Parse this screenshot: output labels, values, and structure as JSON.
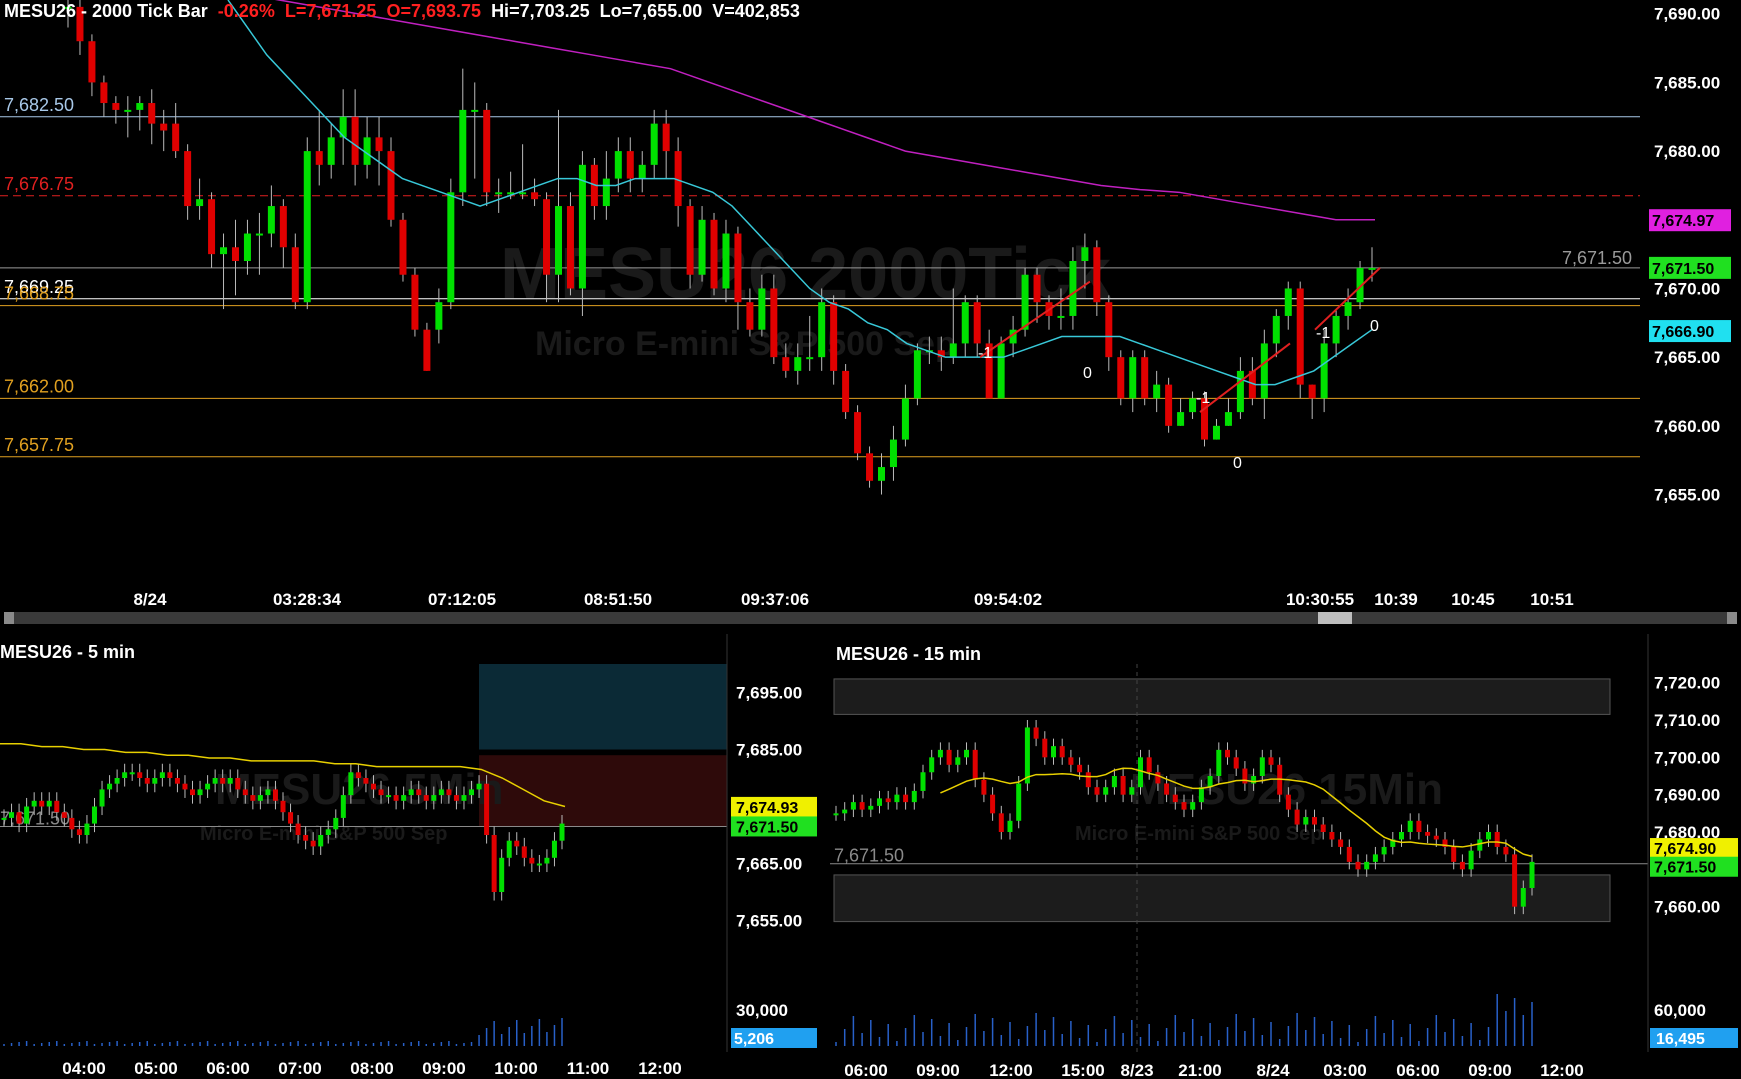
{
  "colors": {
    "up": "#00e000",
    "down": "#e00000",
    "axis_text": "#ffffff",
    "grid_line": "#4a4a4a",
    "ema_cyan": "#38c8d8",
    "sma_magenta": "#c020c0",
    "yellow_ma": "#e8d000"
  },
  "main": {
    "symbol_title": "MESU26 - 2000 Tick Bar",
    "change": "-0.26%",
    "last": "L=7,671.25",
    "open": "O=7,693.75",
    "hi": "Hi=7,703.25",
    "lo": "Lo=7,655.00",
    "volume": "V=402,853",
    "watermark": "MESU26 2000Tick",
    "watermark_sub": "Micro E-mini S&P 500 Sep",
    "y_ticks": [
      "7,690.00",
      "7,685.00",
      "7,680.00",
      "7,675.00",
      "7,670.00",
      "7,665.00",
      "7,660.00",
      "7,655.00"
    ],
    "x_ticks": [
      "8/24",
      "03:28:34",
      "07:12:05",
      "08:51:50",
      "09:37:06",
      "09:54:02",
      "10:30:55",
      "10:39",
      "10:45",
      "10:51"
    ],
    "levels": [
      {
        "label": "7,682.50",
        "color": "#a8c8e8"
      },
      {
        "label": "7,676.75",
        "color": "#e02020"
      },
      {
        "label": "7,669.25",
        "color": "#ffffff"
      },
      {
        "label": "7,668.75",
        "color": "#e0a020"
      },
      {
        "label": "7,662.00",
        "color": "#e0a020"
      },
      {
        "label": "7,657.75",
        "color": "#e0a020"
      }
    ],
    "last_line_label": "7,671.50",
    "price_tags": [
      {
        "label": "7,674.97",
        "bg": "#e020e0",
        "fg": "#000000"
      },
      {
        "label": "7,671.50",
        "bg": "#20e020",
        "fg": "#000000"
      },
      {
        "label": "7,666.90",
        "bg": "#20e0f0",
        "fg": "#000000"
      }
    ],
    "swing_labels": [
      "-1",
      "0",
      "-1",
      "0",
      "-1",
      "0"
    ],
    "chart_data": {
      "type": "candlestick",
      "ylim": [
        7653,
        7691
      ],
      "candles": [
        {
          "o": 7690.5,
          "c": 7690.5,
          "h": 7691.5,
          "l": 7689
        },
        {
          "o": 7690.5,
          "c": 7688,
          "h": 7691,
          "l": 7687
        },
        {
          "o": 7688,
          "c": 7685,
          "h": 7688.5,
          "l": 7684
        },
        {
          "o": 7685,
          "c": 7683.5,
          "h": 7685.5,
          "l": 7682.5
        },
        {
          "o": 7683.5,
          "c": 7683,
          "h": 7684,
          "l": 7682
        },
        {
          "o": 7683,
          "c": 7683,
          "h": 7684,
          "l": 7681
        },
        {
          "o": 7683,
          "c": 7683.5,
          "h": 7684,
          "l": 7681.5
        },
        {
          "o": 7683.5,
          "c": 7682,
          "h": 7684.5,
          "l": 7680.5
        },
        {
          "o": 7682,
          "c": 7681.5,
          "h": 7683,
          "l": 7680
        },
        {
          "o": 7682,
          "c": 7680,
          "h": 7683.5,
          "l": 7679.5
        },
        {
          "o": 7680,
          "c": 7676,
          "h": 7680.5,
          "l": 7675
        },
        {
          "o": 7676,
          "c": 7676.5,
          "h": 7678,
          "l": 7675
        },
        {
          "o": 7676.5,
          "c": 7672.5,
          "h": 7677,
          "l": 7671.5
        },
        {
          "o": 7672.5,
          "c": 7673,
          "h": 7674,
          "l": 7668.5
        },
        {
          "o": 7673,
          "c": 7672,
          "h": 7675,
          "l": 7669.5
        },
        {
          "o": 7672,
          "c": 7674,
          "h": 7675,
          "l": 7671
        },
        {
          "o": 7674,
          "c": 7674,
          "h": 7675.5,
          "l": 7671
        },
        {
          "o": 7674,
          "c": 7676,
          "h": 7677.5,
          "l": 7673
        },
        {
          "o": 7676,
          "c": 7673,
          "h": 7676.5,
          "l": 7671.5
        },
        {
          "o": 7673,
          "c": 7669,
          "h": 7674,
          "l": 7668.5
        },
        {
          "o": 7669,
          "c": 7680,
          "h": 7681,
          "l": 7668.5
        },
        {
          "o": 7680,
          "c": 7679,
          "h": 7683,
          "l": 7677.5
        },
        {
          "o": 7679,
          "c": 7681,
          "h": 7682,
          "l": 7678
        },
        {
          "o": 7681,
          "c": 7682.5,
          "h": 7684.5,
          "l": 7679
        },
        {
          "o": 7682.5,
          "c": 7679,
          "h": 7684.5,
          "l": 7677.5
        },
        {
          "o": 7679,
          "c": 7681,
          "h": 7682.5,
          "l": 7678
        },
        {
          "o": 7681,
          "c": 7680,
          "h": 7682.5,
          "l": 7677.5
        },
        {
          "o": 7680,
          "c": 7675,
          "h": 7681,
          "l": 7674.5
        },
        {
          "o": 7675,
          "c": 7671,
          "h": 7675.5,
          "l": 7670.5
        },
        {
          "o": 7671,
          "c": 7667,
          "h": 7671.5,
          "l": 7666.5
        },
        {
          "o": 7667,
          "c": 7664,
          "h": 7667.5,
          "l": 7664
        },
        {
          "o": 7667,
          "c": 7669,
          "h": 7670,
          "l": 7666
        },
        {
          "o": 7669,
          "c": 7677,
          "h": 7678,
          "l": 7668.5
        },
        {
          "o": 7677,
          "c": 7683,
          "h": 7686,
          "l": 7676
        },
        {
          "o": 7683,
          "c": 7683,
          "h": 7685,
          "l": 7678
        },
        {
          "o": 7683,
          "c": 7677,
          "h": 7683.5,
          "l": 7676
        },
        {
          "o": 7677,
          "c": 7677,
          "h": 7678,
          "l": 7675.5
        },
        {
          "o": 7677,
          "c": 7677,
          "h": 7678.5,
          "l": 7676.5
        },
        {
          "o": 7677,
          "c": 7677,
          "h": 7680.5,
          "l": 7676.5
        },
        {
          "o": 7677,
          "c": 7676.5,
          "h": 7678,
          "l": 7676
        },
        {
          "o": 7676.5,
          "c": 7671,
          "h": 7677,
          "l": 7669
        },
        {
          "o": 7671,
          "c": 7676,
          "h": 7683,
          "l": 7669
        },
        {
          "o": 7676,
          "c": 7670,
          "h": 7677,
          "l": 7669.5
        },
        {
          "o": 7670,
          "c": 7679,
          "h": 7680,
          "l": 7668
        },
        {
          "o": 7679,
          "c": 7676,
          "h": 7679.5,
          "l": 7675
        },
        {
          "o": 7676,
          "c": 7678,
          "h": 7680,
          "l": 7675
        },
        {
          "o": 7678,
          "c": 7680,
          "h": 7681,
          "l": 7677
        },
        {
          "o": 7680,
          "c": 7678,
          "h": 7681,
          "l": 7677
        },
        {
          "o": 7678,
          "c": 7679,
          "h": 7680,
          "l": 7677
        },
        {
          "o": 7679,
          "c": 7682,
          "h": 7683,
          "l": 7678
        },
        {
          "o": 7682,
          "c": 7680,
          "h": 7683,
          "l": 7678
        },
        {
          "o": 7680,
          "c": 7676,
          "h": 7681,
          "l": 7674.5
        },
        {
          "o": 7676,
          "c": 7671,
          "h": 7676.5,
          "l": 7670
        },
        {
          "o": 7671,
          "c": 7675,
          "h": 7676,
          "l": 7670.5
        },
        {
          "o": 7675,
          "c": 7670,
          "h": 7675.5,
          "l": 7669.5
        },
        {
          "o": 7670,
          "c": 7674,
          "h": 7675,
          "l": 7669
        },
        {
          "o": 7674,
          "c": 7669,
          "h": 7674.5,
          "l": 7667
        },
        {
          "o": 7669,
          "c": 7667,
          "h": 7670,
          "l": 7666.5
        },
        {
          "o": 7667,
          "c": 7670,
          "h": 7671,
          "l": 7666.5
        },
        {
          "o": 7670,
          "c": 7665,
          "h": 7671,
          "l": 7664.5
        },
        {
          "o": 7665,
          "c": 7664,
          "h": 7666,
          "l": 7663.5
        },
        {
          "o": 7664,
          "c": 7665,
          "h": 7666,
          "l": 7663
        },
        {
          "o": 7665,
          "c": 7665,
          "h": 7668,
          "l": 7664
        },
        {
          "o": 7665,
          "c": 7669,
          "h": 7670,
          "l": 7664
        },
        {
          "o": 7669,
          "c": 7664,
          "h": 7669.5,
          "l": 7663
        },
        {
          "o": 7664,
          "c": 7661,
          "h": 7664.5,
          "l": 7660.5
        },
        {
          "o": 7661,
          "c": 7658,
          "h": 7661.5,
          "l": 7657.5
        },
        {
          "o": 7658,
          "c": 7656,
          "h": 7658.5,
          "l": 7655.5
        },
        {
          "o": 7656,
          "c": 7657,
          "h": 7658,
          "l": 7655
        },
        {
          "o": 7657,
          "c": 7659,
          "h": 7660,
          "l": 7656
        },
        {
          "o": 7659,
          "c": 7662,
          "h": 7663,
          "l": 7658.5
        },
        {
          "o": 7662,
          "c": 7665.5,
          "h": 7666,
          "l": 7661.5
        },
        {
          "o": 7665.5,
          "c": 7665.5,
          "h": 7666.5,
          "l": 7664.5
        },
        {
          "o": 7665.5,
          "c": 7665,
          "h": 7666.5,
          "l": 7664
        },
        {
          "o": 7665,
          "c": 7666,
          "h": 7670,
          "l": 7664.5
        },
        {
          "o": 7666,
          "c": 7669,
          "h": 7669.5,
          "l": 7665
        },
        {
          "o": 7669,
          "c": 7666,
          "h": 7669.5,
          "l": 7665
        },
        {
          "o": 7666,
          "c": 7662,
          "h": 7667,
          "l": 7662
        },
        {
          "o": 7662,
          "c": 7666,
          "h": 7666.5,
          "l": 7662
        },
        {
          "o": 7666,
          "c": 7667,
          "h": 7668,
          "l": 7665
        },
        {
          "o": 7667,
          "c": 7671,
          "h": 7671.5,
          "l": 7666.5
        },
        {
          "o": 7671,
          "c": 7669,
          "h": 7671.5,
          "l": 7667.5
        },
        {
          "o": 7669,
          "c": 7668,
          "h": 7669.5,
          "l": 7667
        },
        {
          "o": 7668,
          "c": 7668,
          "h": 7670,
          "l": 7667
        },
        {
          "o": 7668,
          "c": 7672,
          "h": 7673,
          "l": 7667
        },
        {
          "o": 7672,
          "c": 7673,
          "h": 7674,
          "l": 7670
        },
        {
          "o": 7673,
          "c": 7669,
          "h": 7673.5,
          "l": 7668
        },
        {
          "o": 7669,
          "c": 7665,
          "h": 7669.5,
          "l": 7664
        },
        {
          "o": 7665,
          "c": 7662,
          "h": 7665.5,
          "l": 7661.5
        },
        {
          "o": 7662,
          "c": 7665,
          "h": 7665.5,
          "l": 7661
        },
        {
          "o": 7665,
          "c": 7662,
          "h": 7665.5,
          "l": 7661.5
        },
        {
          "o": 7662,
          "c": 7663,
          "h": 7664,
          "l": 7661
        },
        {
          "o": 7663,
          "c": 7660,
          "h": 7663.5,
          "l": 7659.5
        },
        {
          "o": 7660,
          "c": 7661,
          "h": 7662,
          "l": 7660
        },
        {
          "o": 7661,
          "c": 7662,
          "h": 7662.5,
          "l": 7660.5
        },
        {
          "o": 7662,
          "c": 7659,
          "h": 7662.5,
          "l": 7658.5
        },
        {
          "o": 7659,
          "c": 7660,
          "h": 7660.5,
          "l": 7659
        },
        {
          "o": 7660,
          "c": 7661,
          "h": 7662,
          "l": 7660
        },
        {
          "o": 7661,
          "c": 7664,
          "h": 7665,
          "l": 7660.5
        },
        {
          "o": 7664,
          "c": 7662,
          "h": 7665,
          "l": 7661.5
        },
        {
          "o": 7662,
          "c": 7666,
          "h": 7667,
          "l": 7660.5
        },
        {
          "o": 7666,
          "c": 7668,
          "h": 7668.5,
          "l": 7665
        },
        {
          "o": 7668,
          "c": 7670,
          "h": 7670.5,
          "l": 7667
        },
        {
          "o": 7670,
          "c": 7663,
          "h": 7670.5,
          "l": 7662
        },
        {
          "o": 7663,
          "c": 7662,
          "h": 7663,
          "l": 7660.5
        },
        {
          "o": 7662,
          "c": 7666,
          "h": 7667,
          "l": 7661
        },
        {
          "o": 7666,
          "c": 7668,
          "h": 7668.5,
          "l": 7665
        },
        {
          "o": 7668,
          "c": 7669,
          "h": 7670,
          "l": 7667
        },
        {
          "o": 7669,
          "c": 7671.5,
          "h": 7672,
          "l": 7668.5
        },
        {
          "o": 7671.5,
          "c": 7671.5,
          "h": 7673,
          "l": 7670.5
        }
      ],
      "ema_cyan": [
        7691,
        7689,
        7687,
        7685.5,
        7684,
        7682.5,
        7681,
        7680,
        7679,
        7678,
        7677.5,
        7677,
        7676.5,
        7676,
        7676.5,
        7677,
        7677.5,
        7678,
        7678,
        7677.5,
        7677.5,
        7678,
        7678,
        7678,
        7677.5,
        7677,
        7676,
        7674.5,
        7673,
        7671.5,
        7670,
        7669,
        7668.5,
        7667.5,
        7667,
        7666,
        7665.5,
        7665,
        7665,
        7665,
        7665,
        7665.5,
        7666,
        7666.5,
        7666.5,
        7666.5,
        7666.5,
        7666,
        7665.5,
        7665,
        7664.5,
        7664,
        7663.5,
        7663,
        7663,
        7663.5,
        7664,
        7665,
        7666,
        7667
      ],
      "sma_magenta": [
        7691.5,
        7691,
        7690.5,
        7690,
        7689.5,
        7689,
        7688.5,
        7688,
        7687.5,
        7687,
        7686.5,
        7686,
        7685,
        7684,
        7683,
        7682,
        7681,
        7680,
        7679.5,
        7679,
        7678.5,
        7678,
        7677.5,
        7677.2,
        7677,
        7676.5,
        7676,
        7675.5,
        7675,
        7675
      ],
      "swing_line_points": [
        [
          7665,
          7670.5
        ],
        [
          7661,
          7666
        ],
        [
          7667,
          7671.5
        ]
      ]
    }
  },
  "panel5": {
    "title": "MESU26 - 5 min",
    "watermark": "MESU26 5Min",
    "watermark_sub": "Micro E-mini S&P 500 Sep",
    "y_ticks": [
      "7,695.00",
      "7,685.00",
      "7,665.00",
      "7,655.00"
    ],
    "vol_ticks": [
      "30,000"
    ],
    "x_ticks": [
      "04:00",
      "05:00",
      "06:00",
      "07:00",
      "08:00",
      "09:00",
      "10:00",
      "11:00",
      "12:00"
    ],
    "last_line_label": "7,671.50",
    "price_tags": [
      {
        "label": "7,674.93",
        "bg": "#f0f000",
        "fg": "#000000"
      },
      {
        "label": "7,671.50",
        "bg": "#20e020",
        "fg": "#000000"
      }
    ],
    "vol_tag": {
      "label": "5,206",
      "bg": "#20a0f0",
      "fg": "#ffffff"
    },
    "chart_data": {
      "type": "candlestick",
      "ylim": [
        7650,
        7700
      ],
      "closes": [
        7673,
        7674,
        7672,
        7675,
        7676,
        7675,
        7676,
        7674,
        7673,
        7671,
        7670,
        7672,
        7675,
        7678,
        7679,
        7680,
        7681,
        7681,
        7680,
        7679,
        7680,
        7681,
        7680,
        7679,
        7678,
        7677,
        7678,
        7679,
        7680,
        7679,
        7680,
        7678,
        7677,
        7676,
        7677,
        7678,
        7676,
        7674,
        7672,
        7670,
        7669,
        7668,
        7670,
        7671,
        7673,
        7677,
        7681,
        7680,
        7679,
        7678,
        7677,
        7677,
        7676,
        7677,
        7678,
        7677,
        7676,
        7677,
        7678,
        7677,
        7676,
        7677,
        7678,
        7679,
        7670,
        7660,
        7666,
        7669,
        7668,
        7666,
        7665,
        7665,
        7666,
        7669,
        7672
      ],
      "yellow_ma": [
        7686,
        7686,
        7685.5,
        7685.5,
        7685,
        7685,
        7684.5,
        7684.5,
        7684,
        7684,
        7683.5,
        7683.5,
        7683,
        7683,
        7683,
        7683,
        7682.5,
        7682.5,
        7682,
        7682,
        7682,
        7682,
        7682,
        7681.5,
        7680,
        7678,
        7676,
        7675
      ],
      "volume_max": 30000
    }
  },
  "panel15": {
    "title": "MESU26 - 15 min",
    "watermark": "MESU26 15Min",
    "watermark_sub": "Micro E-mini S&P 500 Sep",
    "y_ticks": [
      "7,720.00",
      "7,710.00",
      "7,700.00",
      "7,690.00",
      "7,680.00",
      "7,660.00"
    ],
    "vol_ticks": [
      "60,000"
    ],
    "x_ticks": [
      "06:00",
      "09:00",
      "12:00",
      "15:00",
      "8/23",
      "21:00",
      "8/24",
      "03:00",
      "06:00",
      "09:00",
      "12:00"
    ],
    "last_line_label": "7,671.50",
    "price_tags": [
      {
        "label": "7,674.90",
        "bg": "#f0f000",
        "fg": "#000000"
      },
      {
        "label": "7,671.50",
        "bg": "#20e020",
        "fg": "#000000"
      }
    ],
    "vol_tag": {
      "label": "16,495",
      "bg": "#20a0f0",
      "fg": "#ffffff"
    },
    "chart_data": {
      "type": "candlestick",
      "ylim": [
        7650,
        7725
      ],
      "closes": [
        7685,
        7686,
        7688,
        7686,
        7687,
        7689,
        7688,
        7690,
        7688,
        7691,
        7696,
        7700,
        7702,
        7698,
        7700,
        7702,
        7694,
        7690,
        7685,
        7680,
        7683,
        7693,
        7708,
        7705,
        7700,
        7703,
        7700,
        7698,
        7696,
        7692,
        7690,
        7692,
        7695,
        7690,
        7692,
        7700,
        7696,
        7693,
        7690,
        7688,
        7686,
        7688,
        7692,
        7695,
        7702,
        7700,
        7697,
        7693,
        7695,
        7700,
        7698,
        7690,
        7686,
        7682,
        7684,
        7682,
        7680,
        7678,
        7676,
        7672,
        7670,
        7672,
        7674,
        7676,
        7678,
        7680,
        7683,
        7680,
        7679,
        7678,
        7676,
        7672,
        7670,
        7675,
        7678,
        7680,
        7676,
        7674,
        7660,
        7665,
        7672
      ]
    }
  }
}
